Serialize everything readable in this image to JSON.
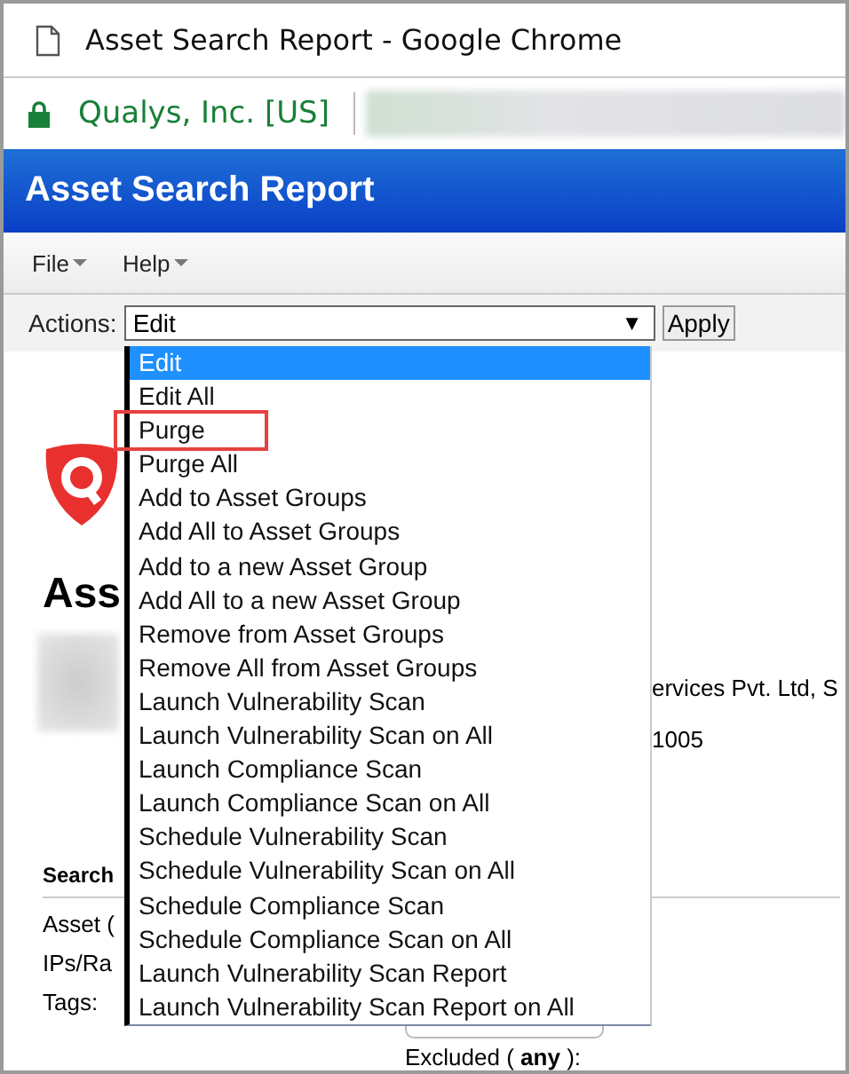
{
  "window": {
    "title": "Asset Search Report - Google Chrome"
  },
  "address_bar": {
    "site_identity": "Qualys, Inc. [US]"
  },
  "header": {
    "title": "Asset Search Report"
  },
  "menu": [
    {
      "label": "File"
    },
    {
      "label": "Help"
    }
  ],
  "actions": {
    "label": "Actions:",
    "value": "Edit",
    "arrow": "▼",
    "button": "Apply"
  },
  "dropdown": {
    "options": [
      {
        "label": "Edit",
        "selected": true,
        "highlighted": false
      },
      {
        "label": "Edit All",
        "selected": false,
        "highlighted": false
      },
      {
        "label": "Purge",
        "selected": false,
        "highlighted": true
      },
      {
        "label": "Purge All",
        "selected": false,
        "highlighted": false
      },
      {
        "label": "Add to Asset Groups",
        "selected": false,
        "highlighted": false
      },
      {
        "label": "Add All to Asset Groups",
        "selected": false,
        "highlighted": false
      },
      {
        "label": "Add to a new Asset Group",
        "selected": false,
        "highlighted": false
      },
      {
        "label": "Add All to a new Asset Group",
        "selected": false,
        "highlighted": false
      },
      {
        "label": "Remove from Asset Groups",
        "selected": false,
        "highlighted": false
      },
      {
        "label": "Remove All from Asset Groups",
        "selected": false,
        "highlighted": false
      },
      {
        "label": "Launch Vulnerability Scan",
        "selected": false,
        "highlighted": false
      },
      {
        "label": "Launch Vulnerability Scan on All",
        "selected": false,
        "highlighted": false
      },
      {
        "label": "Launch Compliance Scan",
        "selected": false,
        "highlighted": false
      },
      {
        "label": "Launch Compliance Scan on All",
        "selected": false,
        "highlighted": false
      },
      {
        "label": "Schedule Vulnerability Scan",
        "selected": false,
        "highlighted": false
      },
      {
        "label": "Schedule Vulnerability Scan on All",
        "selected": false,
        "highlighted": false
      },
      {
        "label": "Schedule Compliance Scan",
        "selected": false,
        "highlighted": false
      },
      {
        "label": "Schedule Compliance Scan on All",
        "selected": false,
        "highlighted": false
      },
      {
        "label": "Launch Vulnerability Scan Report",
        "selected": false,
        "highlighted": false
      },
      {
        "label": "Launch Vulnerability Scan Report on All",
        "selected": false,
        "highlighted": false
      }
    ]
  },
  "page": {
    "heading": "Ass",
    "company_fragment": "ervices Pvt. Ltd, S",
    "code_fragment": "1005",
    "section": "Search",
    "fields": [
      "Asset (",
      "IPs/Ra",
      "Tags:"
    ],
    "excluded_label": "Excluded ( **any** ):"
  }
}
